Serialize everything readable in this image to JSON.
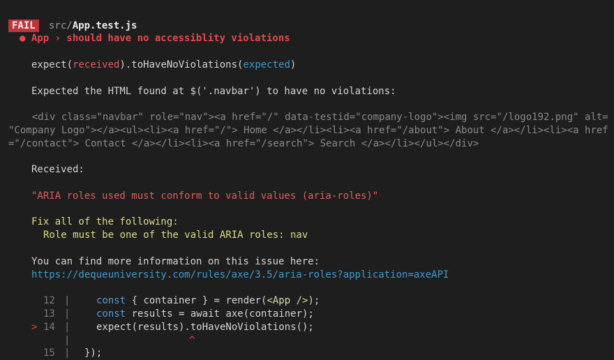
{
  "header": {
    "badge": "FAIL",
    "path_dir": "src/",
    "path_file": "App.test.js",
    "test_name": "● App › should have no accessiblity violations"
  },
  "matcher": {
    "prefix": "expect(",
    "received": "received",
    "middle": ").toHaveNoViolations(",
    "expected": "expected",
    "suffix": ")"
  },
  "expected_line": "Expected the HTML found at $('.navbar') to have no violations:",
  "html_lines": [
    "    <div class=\"navbar\" role=\"nav\"><a href=\"/\" data-testid=\"company-logo\"><img src=\"/logo192.png\" alt=",
    "\"Company Logo\"></a><ul><li><a href=\"/\"> Home </a></li><li><a href=\"/about\"> About </a></li><li><a href",
    "=\"/contact\"> Contact </a></li><li><a href=\"/search\"> Search </a></li></ul></div>"
  ],
  "received_label": "Received:",
  "violation": "\"ARIA roles used must conform to valid values (aria-roles)\"",
  "fix_title": "Fix all of the following:",
  "fix_item": "Role must be one of the valid ARIA roles: nav",
  "info_text": "You can find more information on this issue here:",
  "info_link": "https://dequeuniversity.com/rules/axe/3.5/aria-roles?application=axeAPI",
  "code": {
    "l12_num": "12",
    "l12_kw": "const",
    "l12_a": " { container } = render(",
    "l12_jsx": "<App />",
    "l12_b": ");",
    "l13_num": "13",
    "l13_kw": "const",
    "l13_a": " results = await axe(container);",
    "l14_pointer": ">",
    "l14_num": "14",
    "l14_text": "expect(results).toHaveNoViolations();",
    "caret": "^",
    "l15_num": "15",
    "l15_text": "});"
  }
}
